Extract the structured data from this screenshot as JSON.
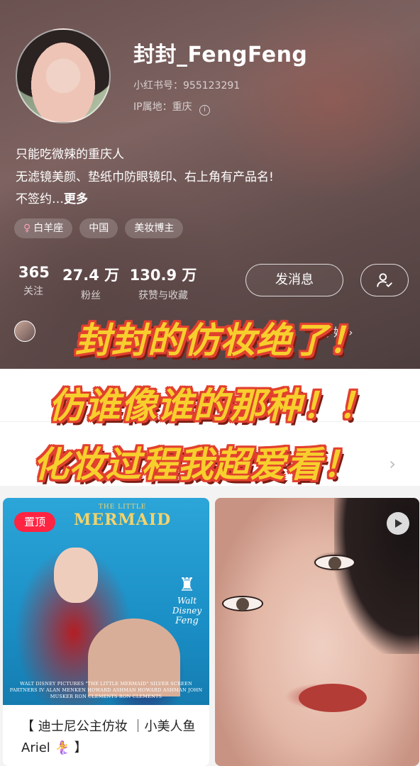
{
  "profile": {
    "username": "封封_FengFeng",
    "id_label": "小红书号：",
    "id_value": "955123291",
    "ip_label": "IP属地：",
    "ip_value": "重庆",
    "bio_line1": "只能吃微辣的重庆人",
    "bio_line2": "无滤镜美颜、垫纸巾防眼镜印、右上角有产品名!",
    "bio_line3": "不签约…",
    "bio_more": "更多",
    "tags": [
      {
        "icon": "female-icon",
        "symbol": "♀",
        "label": "白羊座"
      },
      {
        "label": "中国"
      },
      {
        "label": "美妆博主"
      }
    ],
    "stats": [
      {
        "value": "365",
        "label": "关注"
      },
      {
        "value": "27.4 万",
        "label": "粉丝"
      },
      {
        "value": "130.9 万",
        "label": "获赞与收藏"
      }
    ],
    "message_button": "发消息",
    "follower_text": "注了她 ›"
  },
  "captions": {
    "line1": "封封的仿妆绝了！",
    "line2": "仿谁像谁的那种！！",
    "line3": "化妆过程我超爱看！"
  },
  "feed": {
    "chevron": "›",
    "left_card": {
      "badge": "置顶",
      "cover_title_small": "THE LITTLE",
      "cover_title_big": "MERMAID",
      "cover_brand": "Walt Disney",
      "cover_brand_sub": "Feng",
      "cover_credits": "WALT DISNEY PICTURES \"THE LITTLE MERMAID\" SILVER SCREEN PARTNERS IV ALAN MENKEN HOWARD ASHMAN HOWARD ASHMAN JOHN MUSKER RON CLEMENTS RON CLEMENTS",
      "title": "【 迪士尼公主仿妆 ｜小美人鱼 Ariel 🧜‍♀️ 】"
    }
  },
  "colors": {
    "brand_red": "#ff2442",
    "caption_yellow": "#f7cf2d",
    "caption_outline": "#e2402f"
  }
}
